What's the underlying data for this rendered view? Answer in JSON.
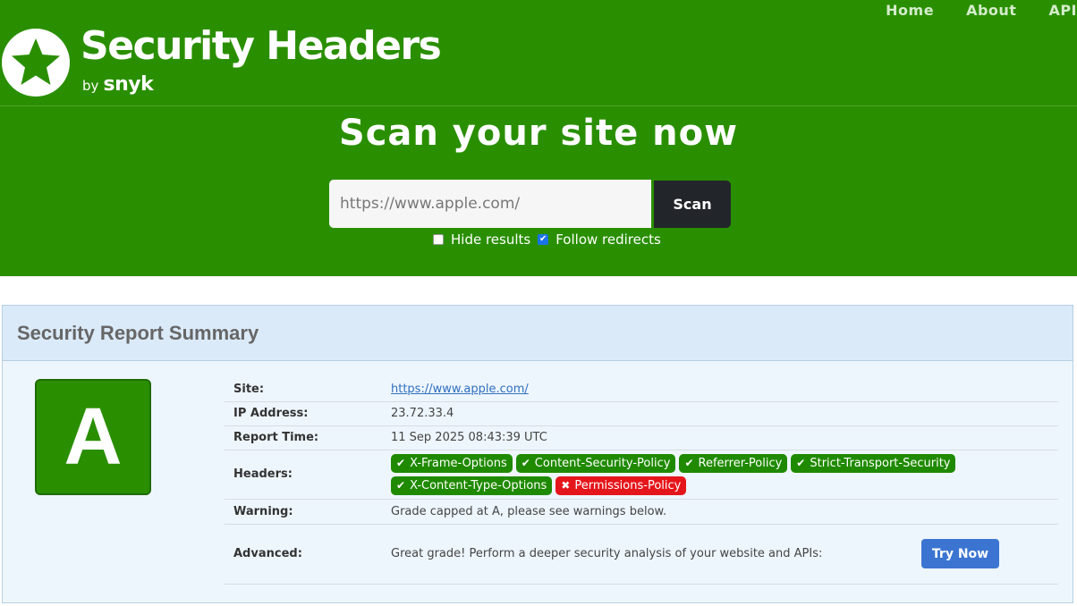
{
  "nav": {
    "items": [
      "Home",
      "About",
      "API"
    ]
  },
  "logo": {
    "title": "Security Headers",
    "by": "by",
    "brand": "snyk"
  },
  "hero": {
    "title": "Scan your site now",
    "search_value": "https://www.apple.com/",
    "scan_label": "Scan",
    "option_hide": "Hide results",
    "option_follow": "Follow redirects",
    "hide_checked": false,
    "follow_checked": true
  },
  "report": {
    "title": "Security Report Summary",
    "grade": "A",
    "rows": {
      "site_label": "Site:",
      "site_value": "https://www.apple.com/",
      "ip_label": "IP Address:",
      "ip_value": "23.72.33.4",
      "time_label": "Report Time:",
      "time_value": "11 Sep 2025 08:43:39 UTC",
      "headers_label": "Headers:",
      "warning_label": "Warning:",
      "warning_value": "Grade capped at A, please see warnings below.",
      "advanced_label": "Advanced:",
      "advanced_value": "Great grade! Perform a deeper security analysis of your website and APIs:",
      "try_label": "Try Now"
    },
    "headers": [
      {
        "name": "X-Frame-Options",
        "status": "ok"
      },
      {
        "name": "Content-Security-Policy",
        "status": "ok"
      },
      {
        "name": "Referrer-Policy",
        "status": "ok"
      },
      {
        "name": "Strict-Transport-Security",
        "status": "ok"
      },
      {
        "name": "X-Content-Type-Options",
        "status": "ok"
      },
      {
        "name": "Permissions-Policy",
        "status": "missing"
      }
    ]
  },
  "colors": {
    "brand_green": "#2a8f00",
    "ok_badge": "#1f8a00",
    "bad_badge": "#e5161b",
    "try_button": "#3b75d1"
  }
}
